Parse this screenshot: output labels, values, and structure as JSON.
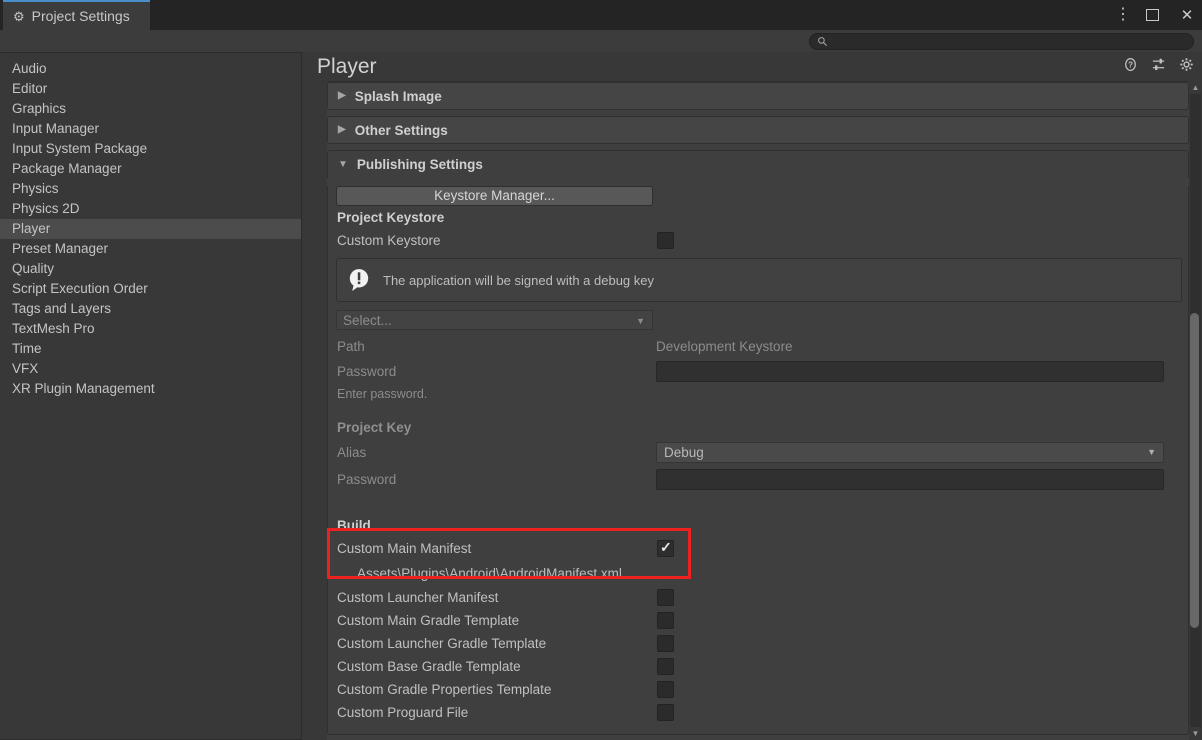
{
  "window": {
    "tab_label": "Project Settings",
    "tab_icon": "gear-icon",
    "controls": {
      "menu_label": "⋮",
      "maximize_label": "",
      "close_label": "✕"
    }
  },
  "search": {
    "value": "",
    "placeholder": "",
    "icon": "search-icon"
  },
  "sidebar": {
    "items": [
      {
        "label": "Audio",
        "selected": false
      },
      {
        "label": "Editor",
        "selected": false
      },
      {
        "label": "Graphics",
        "selected": false
      },
      {
        "label": "Input Manager",
        "selected": false
      },
      {
        "label": "Input System Package",
        "selected": false
      },
      {
        "label": "Package Manager",
        "selected": false
      },
      {
        "label": "Physics",
        "selected": false
      },
      {
        "label": "Physics 2D",
        "selected": false
      },
      {
        "label": "Player",
        "selected": true
      },
      {
        "label": "Preset Manager",
        "selected": false
      },
      {
        "label": "Quality",
        "selected": false
      },
      {
        "label": "Script Execution Order",
        "selected": false
      },
      {
        "label": "Tags and Layers",
        "selected": false
      },
      {
        "label": "TextMesh Pro",
        "selected": false
      },
      {
        "label": "Time",
        "selected": false
      },
      {
        "label": "VFX",
        "selected": false
      },
      {
        "label": "XR Plugin Management",
        "selected": false
      }
    ]
  },
  "main": {
    "title": "Player",
    "header_icons": [
      "help-icon",
      "preset-icon",
      "gear-icon"
    ],
    "foldouts": [
      {
        "label": "Splash Image",
        "expanded": false,
        "arrow": "▶"
      },
      {
        "label": "Other Settings",
        "expanded": false,
        "arrow": "▶"
      },
      {
        "label": "Publishing Settings",
        "expanded": true,
        "arrow": "▼"
      }
    ],
    "publishing": {
      "keystore_manager_button": "Keystore Manager...",
      "project_keystore_header": "Project Keystore",
      "custom_keystore_label": "Custom Keystore",
      "custom_keystore_checked": false,
      "info_icon": "info-exclamation-icon",
      "info_message": "The application will be signed with a debug key",
      "keystore_select": "Select...",
      "path_label": "Path",
      "path_value": "Development Keystore",
      "keystore_password_label": "Password",
      "keystore_password_value": "",
      "password_hint": "Enter password.",
      "project_key_header": "Project Key",
      "alias_label": "Alias",
      "alias_value": "Debug",
      "key_password_label": "Password",
      "key_password_value": ""
    },
    "build": {
      "header": "Build",
      "rows": [
        {
          "label": "Custom Main Manifest",
          "checked": true,
          "highlighted": true,
          "path": "Assets\\Plugins\\Android\\AndroidManifest.xml"
        },
        {
          "label": "Custom Launcher Manifest",
          "checked": false,
          "highlighted": false,
          "path": ""
        },
        {
          "label": "Custom Main Gradle Template",
          "checked": false,
          "highlighted": false,
          "path": ""
        },
        {
          "label": "Custom Launcher Gradle Template",
          "checked": false,
          "highlighted": false,
          "path": ""
        },
        {
          "label": "Custom Base Gradle Template",
          "checked": false,
          "highlighted": false,
          "path": ""
        },
        {
          "label": "Custom Gradle Properties Template",
          "checked": false,
          "highlighted": false,
          "path": ""
        },
        {
          "label": "Custom Proguard File",
          "checked": false,
          "highlighted": false,
          "path": ""
        }
      ]
    }
  },
  "annotation": {
    "color": "#ef2020",
    "target": "Custom Main Manifest"
  },
  "colors": {
    "window_bg": "#383838",
    "titlebar_bg": "#242424",
    "tab_accent": "#4a8ecc",
    "selection": "#4c4c4c",
    "inspector_bg": "#3f3f3f",
    "annotation_red": "#ef2020"
  },
  "scrollbar": {
    "up_arrow": "▲",
    "down_arrow": "▼"
  }
}
